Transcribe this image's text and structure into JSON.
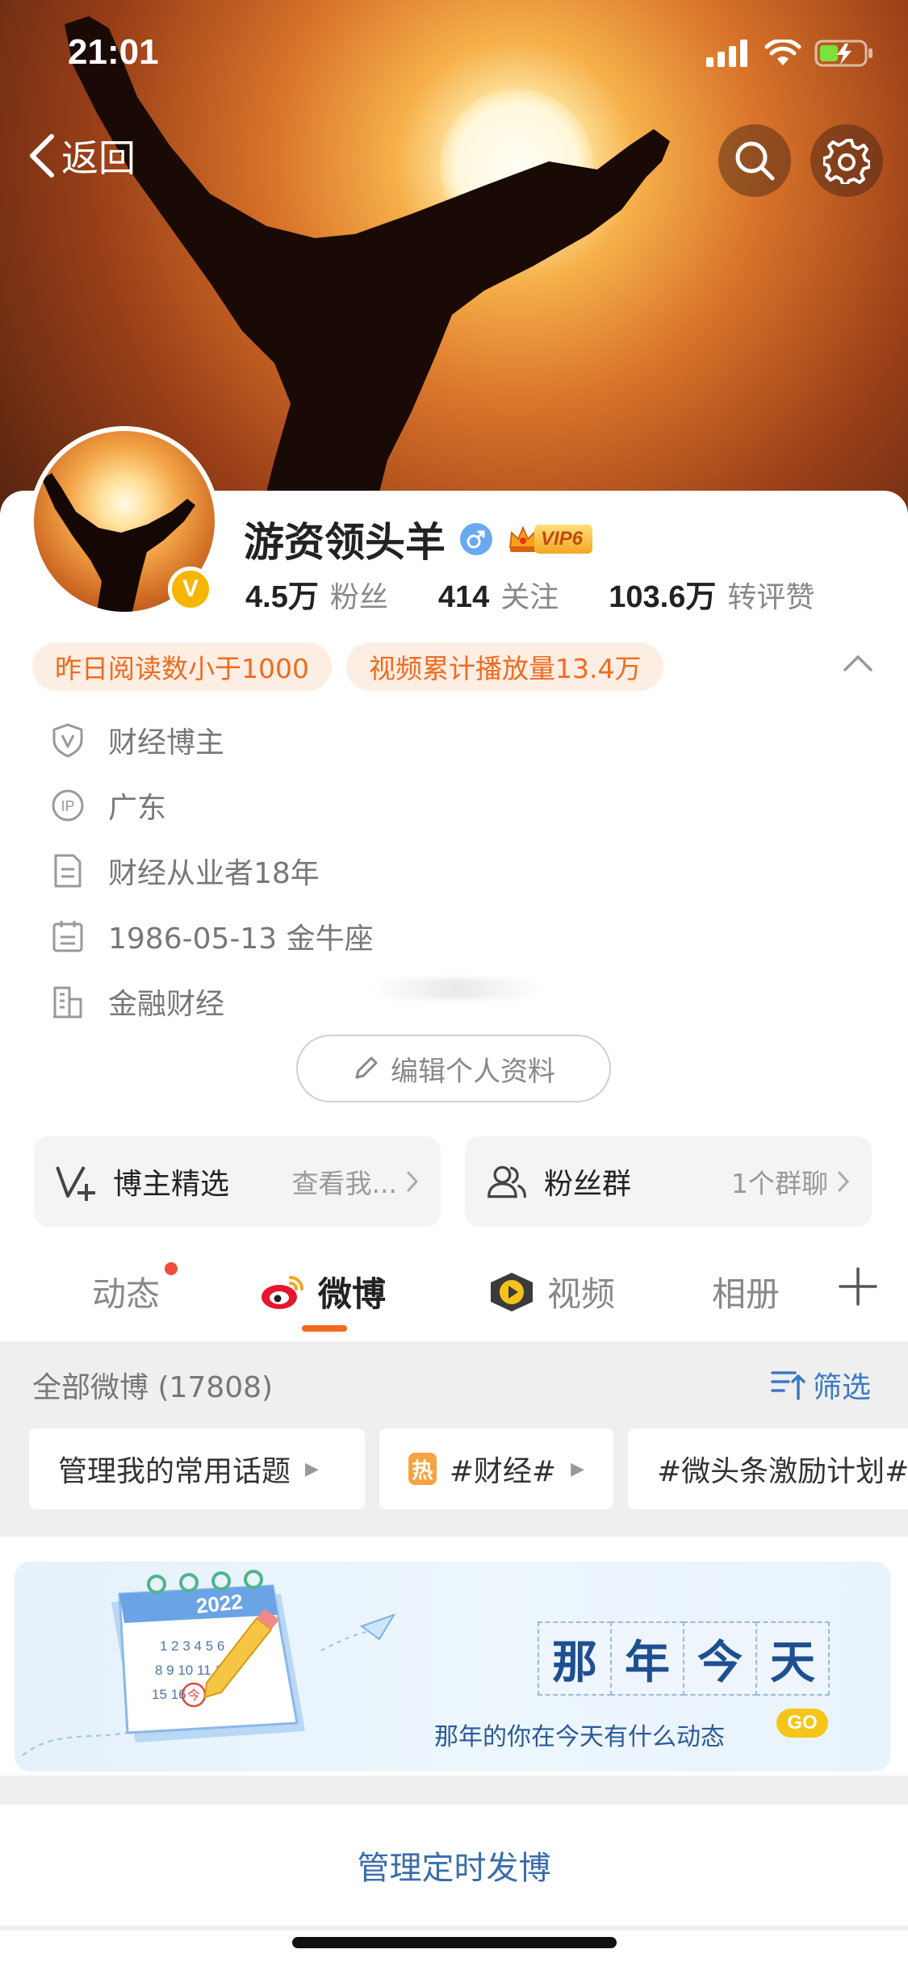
{
  "status_bar": {
    "time": "21:01"
  },
  "nav": {
    "back_label": "返回"
  },
  "profile": {
    "name": "游资领头羊",
    "vip_label": "VIP6",
    "verified_badge": "V",
    "stats": [
      {
        "value": "4.5万",
        "label": "粉丝"
      },
      {
        "value": "414",
        "label": "关注"
      },
      {
        "value": "103.6万",
        "label": "转评赞"
      }
    ],
    "pills": [
      "昨日阅读数小于1000",
      "视频累计播放量13.4万"
    ],
    "info": [
      {
        "icon": "verified-shield-icon",
        "text": "财经博主"
      },
      {
        "icon": "ip-location-icon",
        "text": "广东"
      },
      {
        "icon": "document-icon",
        "text": "财经从业者18年"
      },
      {
        "icon": "calendar-icon",
        "text": "1986-05-13 金牛座"
      },
      {
        "icon": "building-icon",
        "text": "金融财经"
      }
    ],
    "edit_label": "编辑个人资料"
  },
  "feature_cards": [
    {
      "title": "博主精选",
      "subtitle": "查看我..."
    },
    {
      "title": "粉丝群",
      "subtitle": "1个群聊"
    }
  ],
  "tabs": [
    {
      "label": "动态",
      "has_dot": true
    },
    {
      "label": "微博",
      "active": true
    },
    {
      "label": "视频"
    },
    {
      "label": "相册"
    }
  ],
  "feed": {
    "header": "全部微博 (17808)",
    "filter_label": "筛选",
    "topics": [
      {
        "label": "管理我的常用话题",
        "hot": false
      },
      {
        "label": "#财经#",
        "hot": true,
        "hot_tag": "热"
      },
      {
        "label": "#微头条激励计划#",
        "hot": false
      }
    ]
  },
  "banner": {
    "title_chars": [
      "那",
      "年",
      "今",
      "天"
    ],
    "subtitle": "那年的你在今天有什么动态",
    "go_label": "GO",
    "calendar_year": "2022",
    "calendar_today": "今"
  },
  "schedule": {
    "label": "管理定时发博"
  },
  "colors": {
    "accent_orange": "#f26b1c",
    "link_blue": "#3b6ea8",
    "pill_bg": "#fdeee4",
    "pill_text": "#f06b1f"
  }
}
